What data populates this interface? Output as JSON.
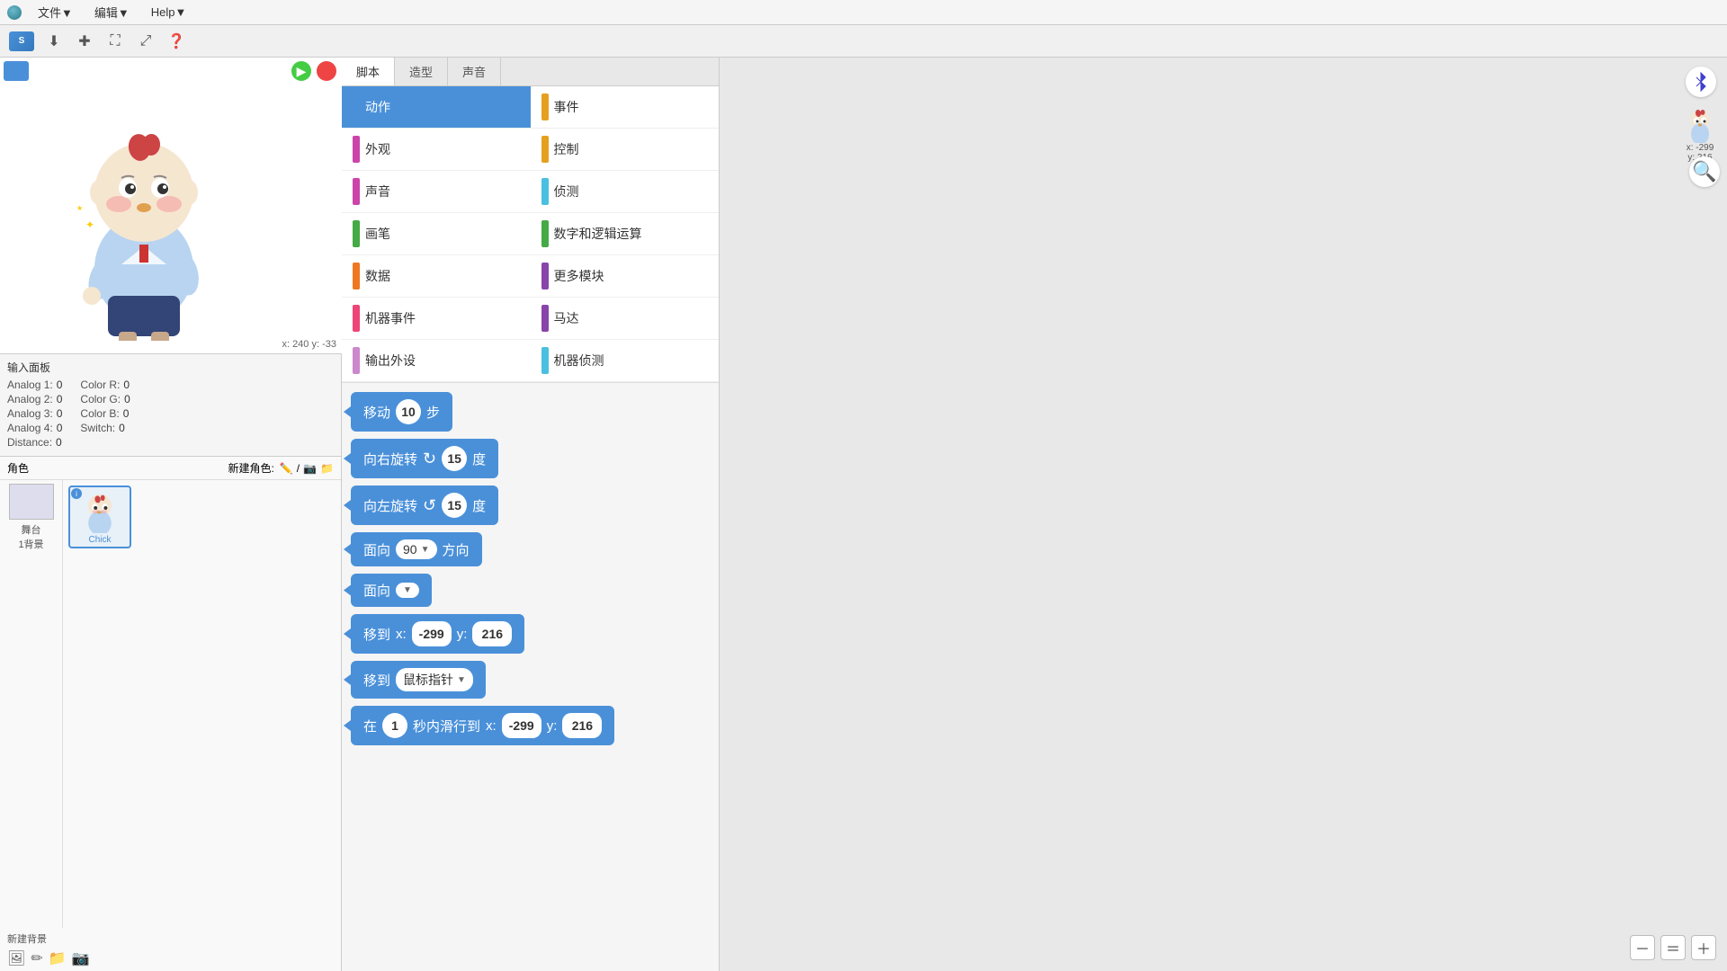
{
  "menubar": {
    "items": [
      "文件▼",
      "编辑▼",
      "Help▼"
    ]
  },
  "toolbar": {
    "logo_label": "S"
  },
  "stage": {
    "coords": "x: 240  y: -33",
    "tabs": [
      "脚本",
      "造型",
      "声音"
    ]
  },
  "input_panel": {
    "title": "输入面板",
    "rows": [
      [
        {
          "label": "Analog 1:",
          "value": "0"
        },
        {
          "label": "Color R:",
          "value": "0"
        }
      ],
      [
        {
          "label": "Analog 2:",
          "value": "0"
        },
        {
          "label": "Color G:",
          "value": "0"
        }
      ],
      [
        {
          "label": "Analog 3:",
          "value": "0"
        },
        {
          "label": "Color B:",
          "value": "0"
        }
      ],
      [
        {
          "label": "Analog 4:",
          "value": "0"
        },
        {
          "label": "Switch:",
          "value": "0"
        }
      ],
      [
        {
          "label": "Distance:",
          "value": "0"
        },
        {
          "label": "",
          "value": ""
        }
      ]
    ]
  },
  "sprite_panel": {
    "header": "角色",
    "new_label": "新建角色:",
    "stage_label": "舞台",
    "stage_bg": "1背景",
    "new_bg_label": "新建背景",
    "sprite_name": "Chick"
  },
  "categories": [
    {
      "label": "动作",
      "color": "#4a90d9",
      "active": true
    },
    {
      "label": "事件",
      "color": "#e6a020"
    },
    {
      "label": "外观",
      "color": "#cc44aa"
    },
    {
      "label": "控制",
      "color": "#e6a020"
    },
    {
      "label": "声音",
      "color": "#cc44aa"
    },
    {
      "label": "侦测",
      "color": "#4ac0e0"
    },
    {
      "label": "画笔",
      "color": "#44aa44"
    },
    {
      "label": "数字和逻辑运算",
      "color": "#44aa44"
    },
    {
      "label": "数据",
      "color": "#ee7722"
    },
    {
      "label": "更多模块",
      "color": "#8844aa"
    },
    {
      "label": "机器事件",
      "color": "#ee4477"
    },
    {
      "label": "马达",
      "color": "#8844aa"
    },
    {
      "label": "输出外设",
      "color": "#cc88cc"
    },
    {
      "label": "机器侦测",
      "color": "#4ac0e0"
    }
  ],
  "blocks": [
    {
      "id": "move",
      "prefix": "移动",
      "value": "10",
      "suffix": "步",
      "type": "move"
    },
    {
      "id": "turn_right",
      "prefix": "向右旋转",
      "icon": "↻",
      "value": "15",
      "suffix": "度",
      "type": "turn"
    },
    {
      "id": "turn_left",
      "prefix": "向左旋转",
      "icon": "↺",
      "value": "15",
      "suffix": "度",
      "type": "turn"
    },
    {
      "id": "face_direction",
      "prefix": "面向",
      "dropdown": "90",
      "suffix": "方向",
      "type": "face"
    },
    {
      "id": "face_toward",
      "prefix": "面向",
      "dropdown": "",
      "type": "face_short"
    },
    {
      "id": "goto_xy",
      "prefix": "移到",
      "x_label": "x:",
      "x_val": "-299",
      "y_label": "y:",
      "y_val": "216",
      "type": "goto_xy"
    },
    {
      "id": "goto_target",
      "prefix": "移到",
      "dropdown": "鼠标指针",
      "type": "goto_target"
    },
    {
      "id": "glide",
      "prefix": "在",
      "value": "1",
      "mid": "秒内滑行到",
      "x_label": "x:",
      "x_val": "-299",
      "y_label": "y:",
      "y_val": "216",
      "type": "glide"
    }
  ],
  "right_panel": {
    "bt_icon": "𝔹",
    "sprite_coords": "x: -299\ny: 216",
    "zoom_minus": "－",
    "zoom_equal": "＝",
    "zoom_plus": "＋"
  }
}
